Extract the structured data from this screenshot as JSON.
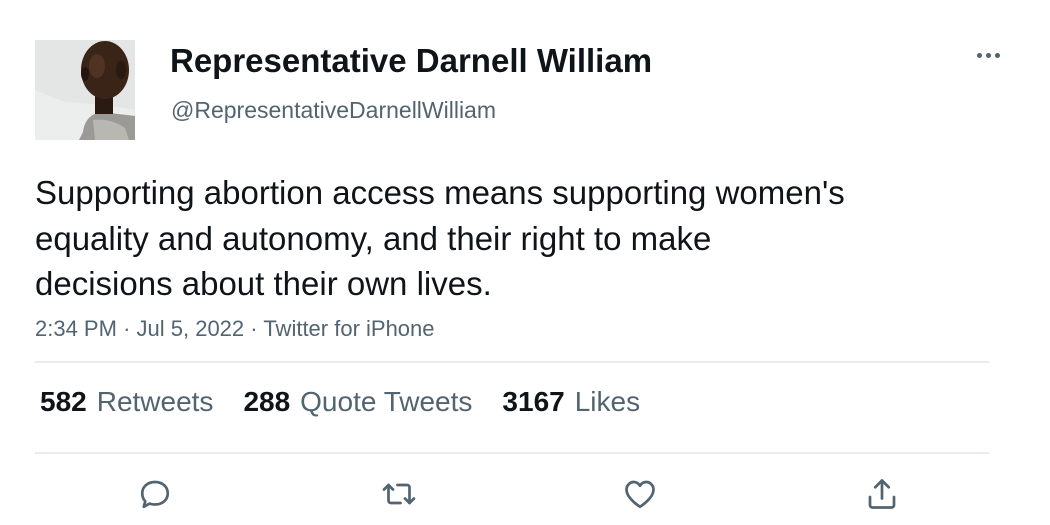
{
  "author": {
    "display_name": "Representative Darnell William",
    "handle": "@RepresentativeDarnellWilliam"
  },
  "tweet": {
    "text_lines": [
      "Supporting abortion access means supporting women's",
      "equality and autonomy, and their right to make",
      "decisions about their own lives."
    ],
    "time": "2:34 PM",
    "date": "Jul 5, 2022",
    "separator": "·",
    "source": "Twitter for iPhone"
  },
  "stats": {
    "retweets": {
      "count": "582",
      "label": "Retweets"
    },
    "quote_tweets": {
      "count": "288",
      "label": "Quote Tweets"
    },
    "likes": {
      "count": "3167",
      "label": "Likes"
    }
  },
  "actions": [
    "reply-icon",
    "retweet-icon",
    "like-icon",
    "share-icon"
  ],
  "colors": {
    "text": "#0f1419",
    "secondary": "#536471",
    "divider": "#e6ecf0"
  }
}
